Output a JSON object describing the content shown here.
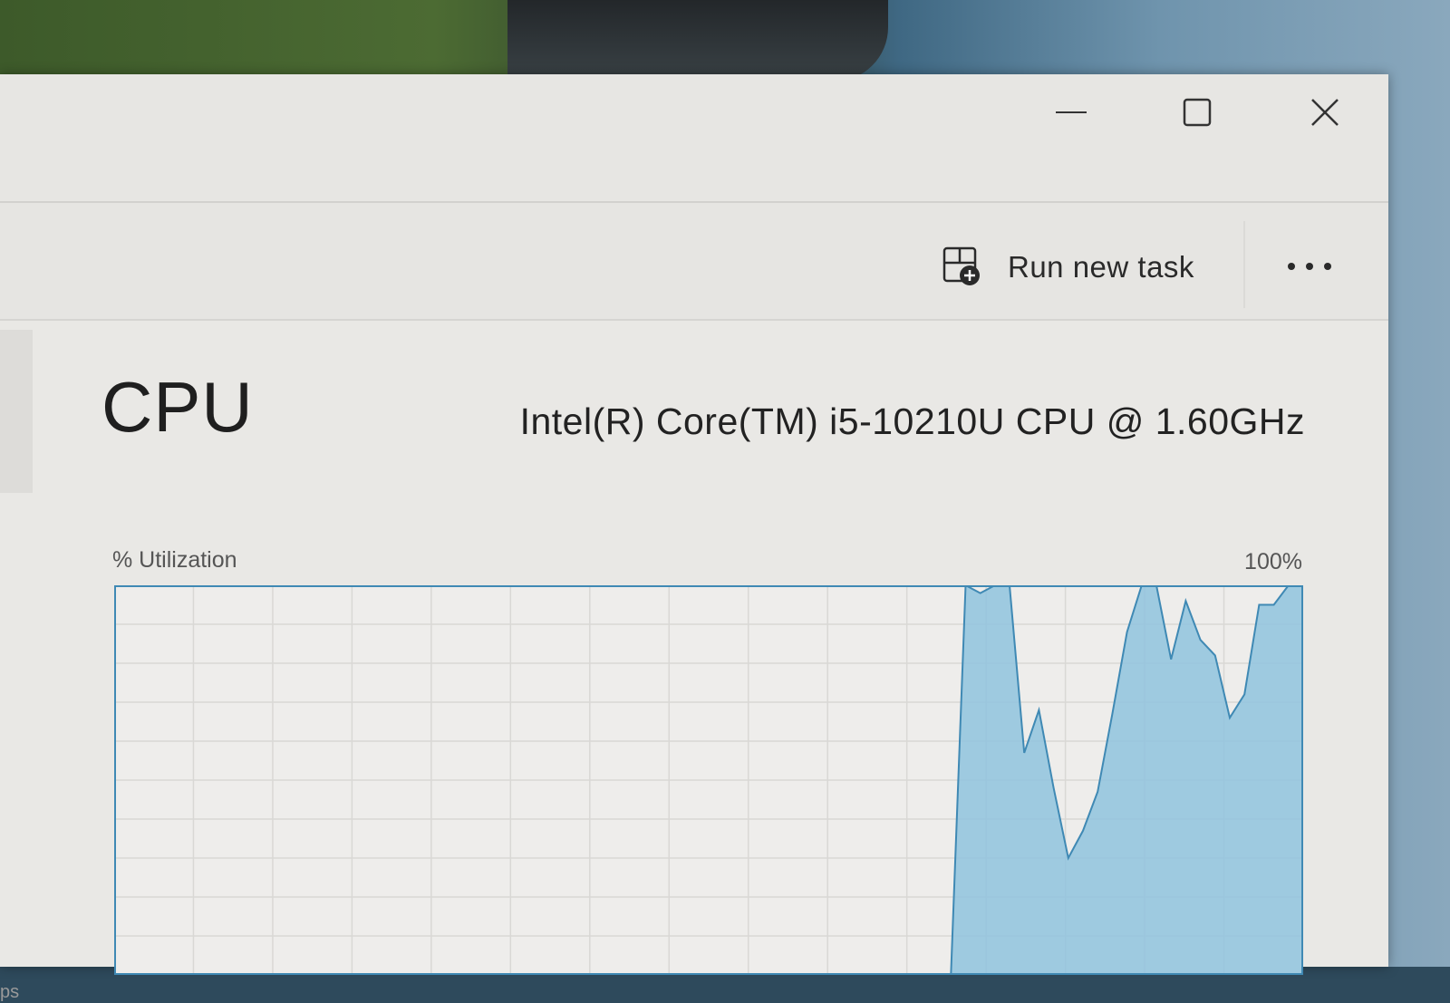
{
  "window": {
    "caption_buttons": [
      "minimize",
      "maximize",
      "close"
    ]
  },
  "toolbar": {
    "run_task_label": "Run new task",
    "run_task_icon": "run-task-icon",
    "more_icon": "more-options-icon"
  },
  "page": {
    "title": "CPU",
    "cpu_model": "Intel(R) Core(TM) i5-10210U CPU @ 1.60GHz",
    "utilization_label": "% Utilization",
    "max_label": "100%",
    "partial_label": "ps"
  },
  "chart_data": {
    "type": "area",
    "title": "",
    "xlabel": "",
    "ylabel": "% Utilization",
    "ylim": [
      0,
      100
    ],
    "grid": true,
    "color": "#8fc3de",
    "line_color": "#3f89b4",
    "series": [
      {
        "values": [
          0,
          0,
          0,
          0,
          0,
          0,
          0,
          0,
          0,
          0,
          0,
          0,
          0,
          0,
          0,
          0,
          0,
          0,
          0,
          0,
          0,
          0,
          0,
          0,
          0,
          0,
          0,
          0,
          0,
          0,
          0,
          0,
          0,
          0,
          0,
          0,
          0,
          0,
          0,
          0,
          0,
          0,
          0,
          0,
          0,
          0,
          0,
          0,
          0,
          0,
          0,
          0,
          0,
          0,
          0,
          0,
          0,
          0,
          100,
          98,
          100,
          100,
          57,
          68,
          48,
          30,
          37,
          47,
          67,
          88,
          100,
          100,
          81,
          96,
          86,
          82,
          66,
          72,
          95,
          95,
          100,
          100
        ]
      }
    ]
  }
}
